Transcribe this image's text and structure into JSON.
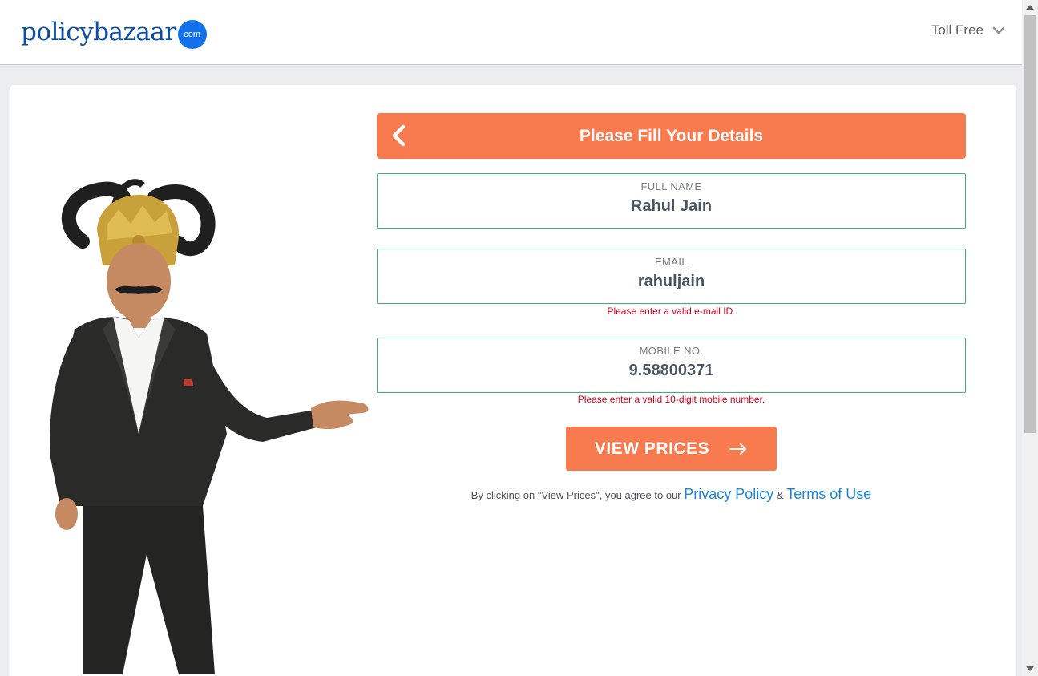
{
  "header": {
    "logo_text": "policybazaar",
    "logo_badge": "com",
    "toll_free_label": "Toll Free"
  },
  "form": {
    "title": "Please Fill Your Details",
    "fields": [
      {
        "label": "FULL NAME",
        "value": "Rahul Jain",
        "error": ""
      },
      {
        "label": "EMAIL",
        "value": "rahuljain",
        "error": "Please enter a valid e-mail ID."
      },
      {
        "label": "MOBILE NO.",
        "value": "9.58800371",
        "error": "Please enter a valid 10-digit mobile number."
      }
    ],
    "submit_label": "VIEW PRICES",
    "consent_prefix": "By clicking on \"View Prices\", you agree to our",
    "privacy_link": "Privacy Policy",
    "consent_and": "&",
    "terms_link": "Terms of Use"
  },
  "colors": {
    "accent": "#f87a4f",
    "brand_blue": "#0c4ea3",
    "field_border": "#3cb371",
    "error": "#d0021b",
    "link": "#1a86e0"
  },
  "icons": {
    "back": "chevron-left-icon",
    "toll_dropdown": "chevron-down-icon",
    "submit": "arrow-right-icon"
  }
}
